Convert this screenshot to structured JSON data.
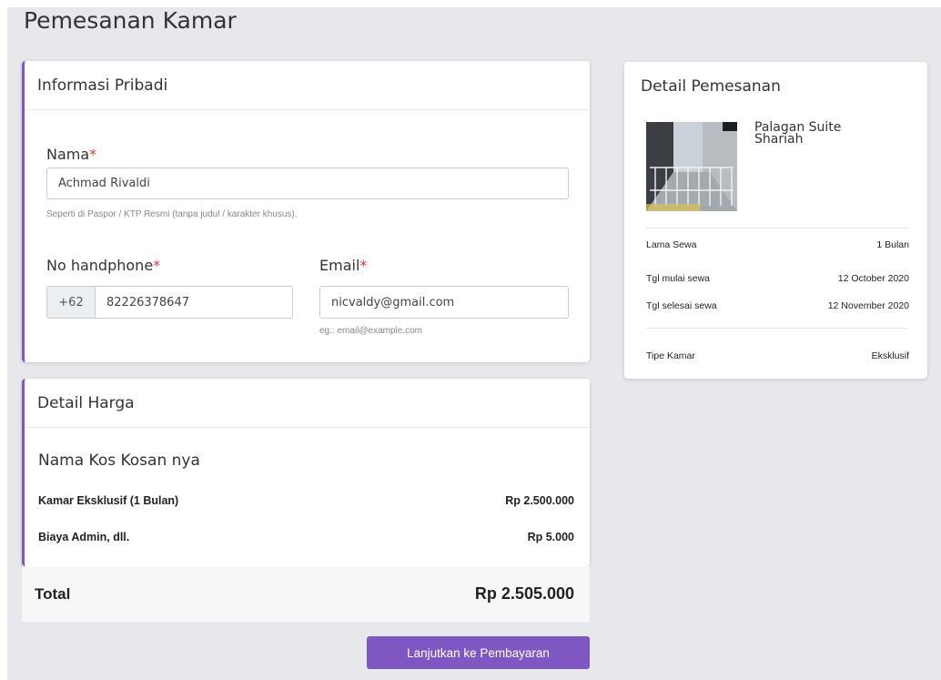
{
  "page": {
    "title": "Pemesanan Kamar"
  },
  "info": {
    "header": "Informasi Pribadi",
    "name_label": "Nama",
    "name_value": "Achmad Rivaldi",
    "name_hint": "Seperti di Paspor / KTP Resmi (tanpa judul / karakter khusus).",
    "phone_label": "No handphone",
    "phone_prefix": "+62",
    "phone_value": "82226378647",
    "email_label": "Email",
    "email_value": "nicvaldy@gmail.com",
    "email_hint": "eg.: email@example.com",
    "required_mark": "*"
  },
  "price": {
    "header": "Detail Harga",
    "kos_name": "Nama Kos Kosan nya",
    "rows": [
      {
        "label": "Kamar Eksklusif (1 Bulan)",
        "value": "Rp 2.500.000"
      },
      {
        "label": "Biaya Admin, dll.",
        "value": "Rp 5.000"
      }
    ],
    "total_label": "Total",
    "total_value": "Rp 2.505.000"
  },
  "action": {
    "continue_label": "Lanjutkan ke Pembayaran"
  },
  "order": {
    "header": "Detail Pemesanan",
    "room_name": "Palagan Suite Shariah",
    "rows": [
      {
        "label": "Lama Sewa",
        "value": "1 Bulan"
      },
      {
        "label": "Tgl mulai sewa",
        "value": "12 October 2020"
      },
      {
        "label": "Tgl selesai sewa",
        "value": "12 November 2020"
      },
      {
        "label": "Tipe Kamar",
        "value": "Eksklusif"
      }
    ]
  },
  "colors": {
    "accent": "#7e57c2",
    "required": "#e53935",
    "page_bg": "#e6e8ec"
  }
}
